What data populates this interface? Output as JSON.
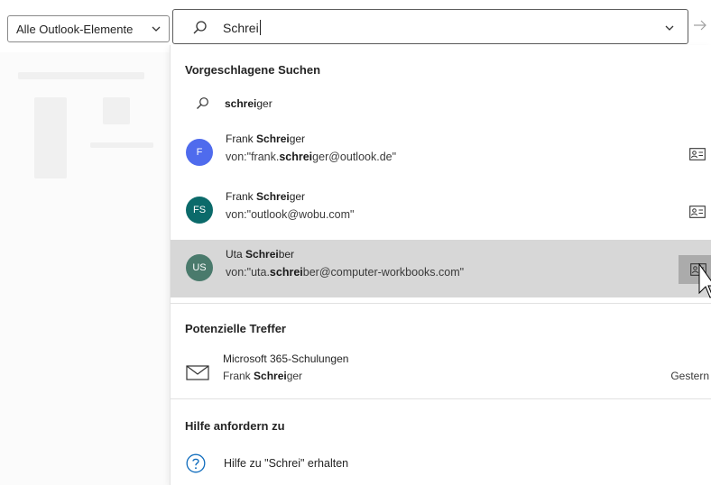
{
  "scope_selector": {
    "label": "Alle Outlook-Elemente",
    "icon": "chevron-down-icon"
  },
  "search": {
    "value": "Schrei",
    "dropdown_icon": "chevron-down-icon",
    "go_icon": "arrow-right-icon"
  },
  "sections": {
    "suggested": "Vorgeschlagene Suchen",
    "potential": "Potenzielle Treffer",
    "help": "Hilfe anfordern zu"
  },
  "suggestion": {
    "pre": "",
    "match": "schrei",
    "post": "ger"
  },
  "people": [
    {
      "initials": "F",
      "avatar_color": "#4f6bed",
      "name_pre": "Frank ",
      "name_match": "Schrei",
      "name_post": "ger",
      "mail_pre": "von:\"frank.",
      "mail_match": "schrei",
      "mail_post": "ger@outlook.de\"",
      "selected": false
    },
    {
      "initials": "FS",
      "avatar_color": "#0b6a6a",
      "name_pre": "Frank ",
      "name_match": "Schrei",
      "name_post": "ger",
      "mail_pre": "von:\"outlook@wobu.com\"",
      "mail_match": "",
      "mail_post": "",
      "selected": false
    },
    {
      "initials": "US",
      "avatar_color": "#4a7a6c",
      "name_pre": "Uta ",
      "name_match": "Schrei",
      "name_post": "ber",
      "mail_pre": "von:\"uta.",
      "mail_match": "schrei",
      "mail_post": "ber@computer-workbooks.com\"",
      "selected": true
    }
  ],
  "hit": {
    "subject": "Microsoft 365-Schulungen",
    "from_pre": "Frank ",
    "from_match": "Schrei",
    "from_post": "ger",
    "date": "Gestern"
  },
  "help_item": {
    "label": "Hilfe zu \"Schrei\" erhalten"
  },
  "colors": {
    "selected_row": "#d7d7d7",
    "contact_card_hover": "#ababab",
    "help_icon": "#0f6cbd"
  }
}
